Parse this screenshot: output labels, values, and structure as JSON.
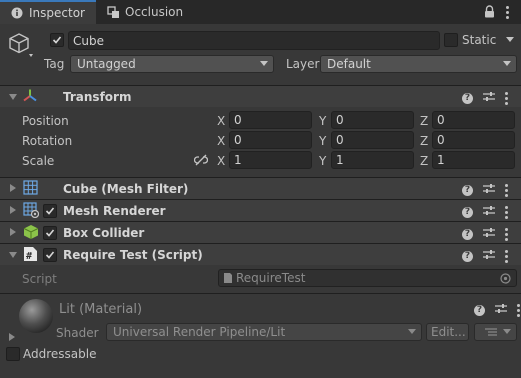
{
  "tabs": [
    {
      "label": "Inspector",
      "icon": "info-icon",
      "active": true
    },
    {
      "label": "Occlusion",
      "icon": "occlusion-icon",
      "active": false
    }
  ],
  "header": {
    "object_name": "Cube",
    "static_label": "Static",
    "tag_label": "Tag",
    "tag_value": "Untagged",
    "layer_label": "Layer",
    "layer_value": "Default"
  },
  "transform": {
    "title": "Transform",
    "rows": [
      {
        "label": "Position",
        "x": "0",
        "y": "0",
        "z": "0"
      },
      {
        "label": "Rotation",
        "x": "0",
        "y": "0",
        "z": "0"
      },
      {
        "label": "Scale",
        "x": "1",
        "y": "1",
        "z": "1"
      }
    ],
    "axis": {
      "x": "X",
      "y": "Y",
      "z": "Z"
    }
  },
  "components": [
    {
      "title": "Cube (Mesh Filter)",
      "has_checkbox": false,
      "icon": "mesh-filter-icon"
    },
    {
      "title": "Mesh Renderer",
      "has_checkbox": true,
      "icon": "mesh-renderer-icon"
    },
    {
      "title": "Box Collider",
      "has_checkbox": true,
      "icon": "box-collider-icon"
    },
    {
      "title": "Require Test (Script)",
      "has_checkbox": true,
      "icon": "script-icon"
    }
  ],
  "script": {
    "label": "Script",
    "value": "RequireTest"
  },
  "material": {
    "name": "Lit (Material)",
    "shader_label": "Shader",
    "shader_value": "Universal Render Pipeline/Lit",
    "edit_label": "Edit..."
  },
  "addressable_label": "Addressable",
  "colors": {
    "background": "#383838",
    "accent": "#3a79bb"
  }
}
